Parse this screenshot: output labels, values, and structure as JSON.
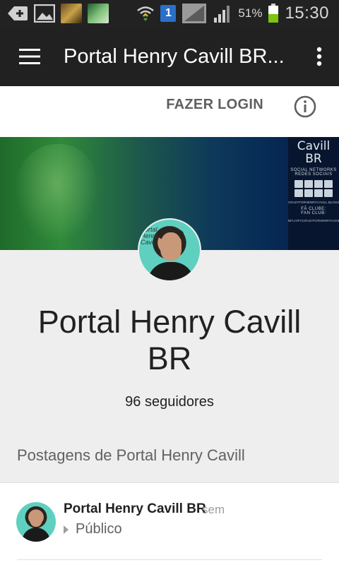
{
  "status_bar": {
    "battery_percent": "51%",
    "time": "15:30",
    "sim_label": "1",
    "battery_level": 0.51,
    "icons": [
      "back-plus-icon",
      "gallery-icon",
      "app-thumbnail-icon",
      "app-thumbnail-icon",
      "wifi-icon",
      "sim-icon",
      "signal-icon",
      "signal-icon",
      "battery-icon"
    ]
  },
  "app_bar": {
    "title": "Portal Henry Cavill BR...",
    "menu_icon": "hamburger-icon",
    "overflow_icon": "more-vert-icon"
  },
  "actions": {
    "login_label": "FAZER LOGIN",
    "info_icon": "info-icon"
  },
  "cover": {
    "logo_line1": "Cavill",
    "logo_line2": "BR",
    "social_line1": "SOCIAL NETWORKS",
    "social_line2": "REDES SOCIAIS",
    "blog_url": "CRAZYFORHENRYCAVILL.BLOGSPOT.COM",
    "fan_club_en": "FÃ CLUBE:",
    "fan_club_pt": "FAN CLUB:",
    "fan_club_url": "BIT.LY/FCCRAZYFORHENRYCAVILLBR"
  },
  "profile": {
    "name_line1": "Portal Henry Cavill",
    "name_line2": "BR",
    "followers": "96 seguidores",
    "avatar_text": "Portal Henry Cavill"
  },
  "posts": {
    "section_title": "Postagens de Portal Henry Cavill",
    "items": [
      {
        "author": "Portal Henry Cavill BR",
        "time_fragment": "sem",
        "visibility": "Público"
      }
    ]
  }
}
